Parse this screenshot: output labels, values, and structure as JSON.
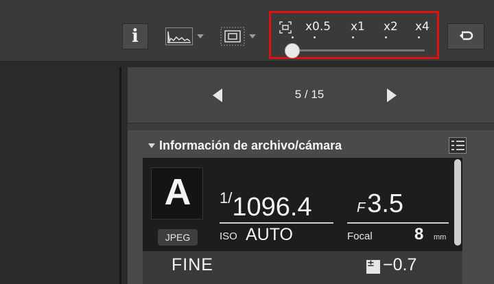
{
  "toolbar": {
    "info_label": "i",
    "zoom": {
      "labels": [
        "x0.5",
        "x1",
        "x2",
        "x4"
      ],
      "selected": "x0.5"
    },
    "icons": {
      "info": "info-icon",
      "histogram": "histogram-icon",
      "af_point": "af-point-icon",
      "undo": "undo-icon"
    }
  },
  "navigation": {
    "count": "5 / 15"
  },
  "panel": {
    "section_title": "Información de archivo/cámara",
    "mode": "A",
    "format": "JPEG",
    "shutter_fraction": "1/",
    "shutter_value": "1096.4",
    "aperture_prefix": "F",
    "aperture_value": "3.5",
    "iso_label": "ISO",
    "iso_value": "AUTO",
    "focal_label": "Focal",
    "focal_value": "8",
    "focal_unit": "mm",
    "quality": "FINE",
    "exposure_compensation": "−0.7"
  },
  "colors": {
    "highlight": "#e01010",
    "toolbar_bg": "#3a3a3a",
    "panel_bg": "#4a4a4a",
    "display_bg": "#1d1d1d"
  }
}
